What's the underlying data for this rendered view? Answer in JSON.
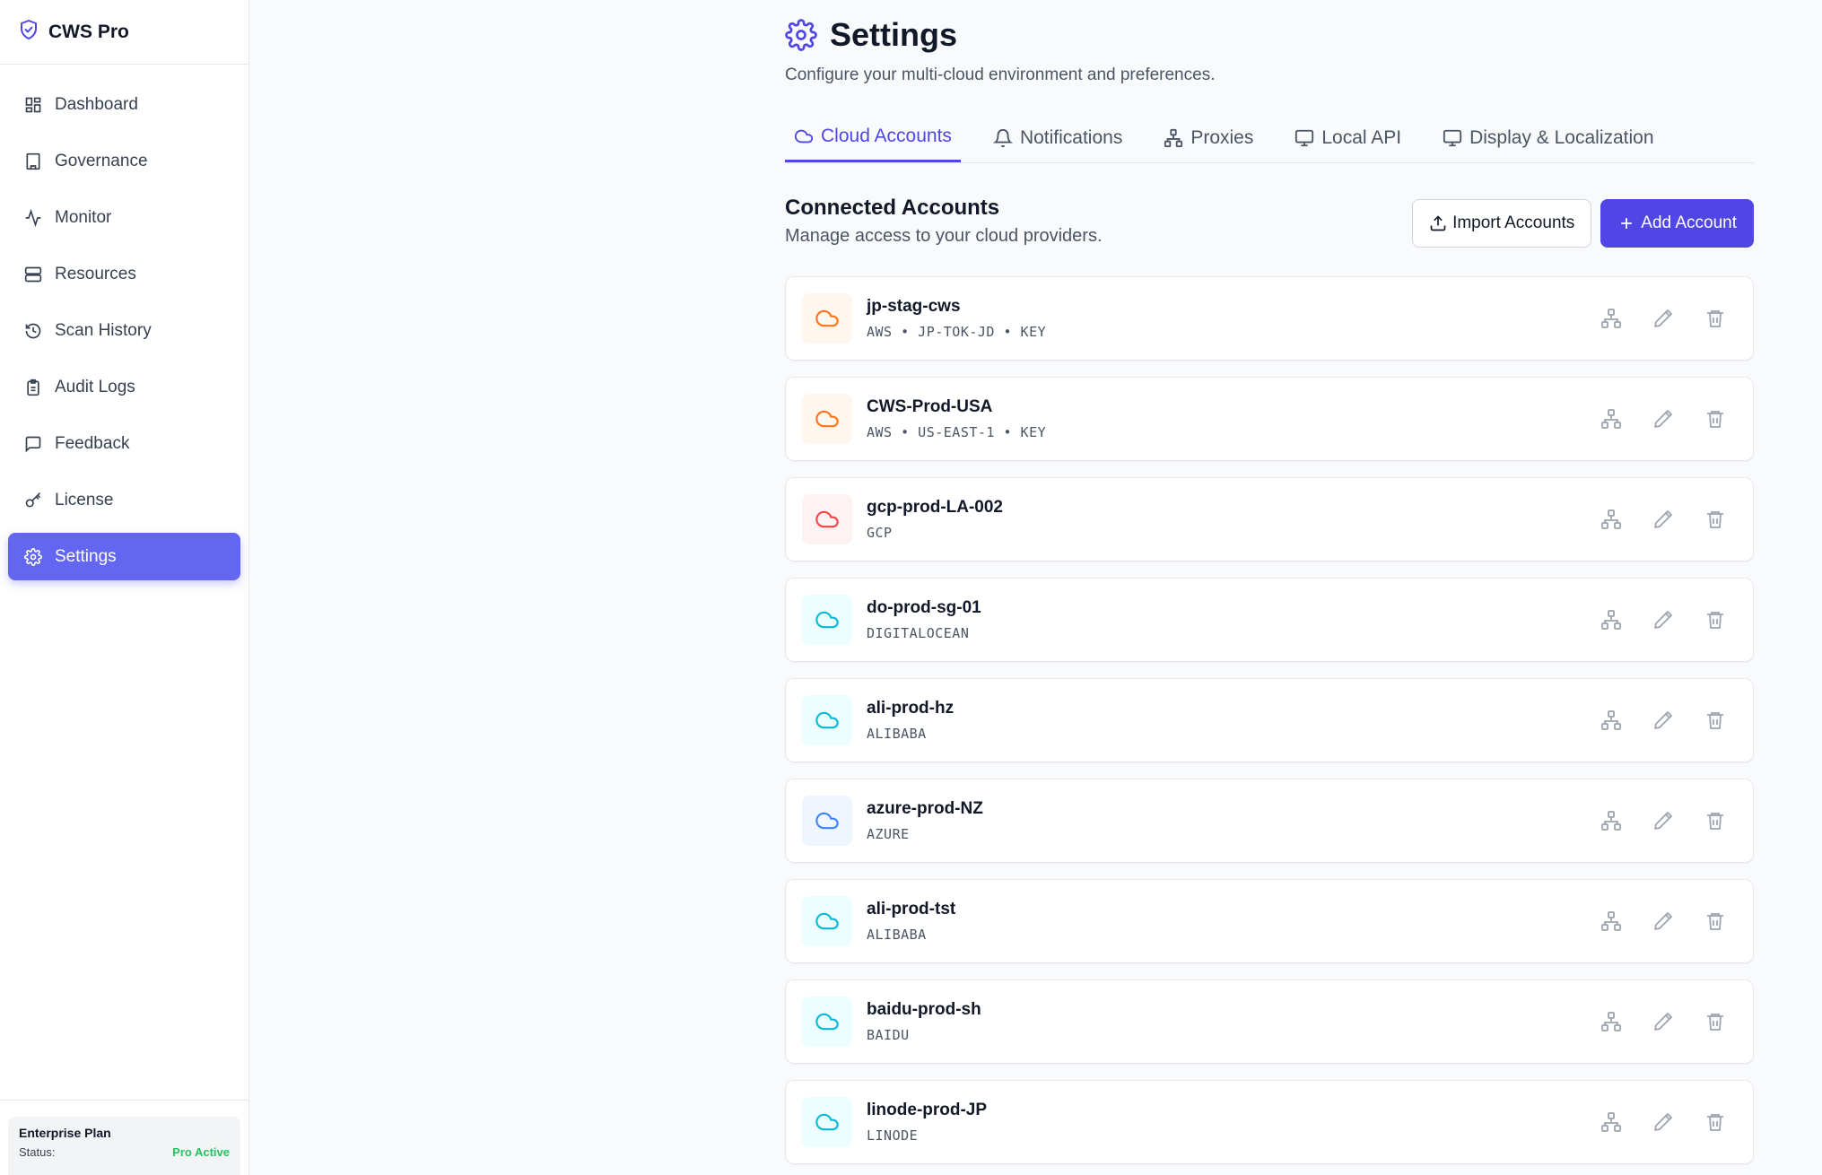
{
  "app": {
    "name": "CWS Pro"
  },
  "sidebar": {
    "items": [
      {
        "label": "Dashboard",
        "icon": "dashboard-icon"
      },
      {
        "label": "Governance",
        "icon": "building-icon"
      },
      {
        "label": "Monitor",
        "icon": "activity-icon"
      },
      {
        "label": "Resources",
        "icon": "server-icon"
      },
      {
        "label": "Scan History",
        "icon": "history-icon"
      },
      {
        "label": "Audit Logs",
        "icon": "clipboard-icon"
      },
      {
        "label": "Feedback",
        "icon": "message-icon"
      },
      {
        "label": "License",
        "icon": "key-icon"
      },
      {
        "label": "Settings",
        "icon": "gear-icon",
        "active": true
      }
    ],
    "plan": {
      "title": "Enterprise Plan",
      "status_label": "Status:",
      "status_value": "Pro Active"
    }
  },
  "header": {
    "title": "Settings",
    "subtitle": "Configure your multi-cloud environment and preferences."
  },
  "tabs": [
    {
      "label": "Cloud Accounts",
      "icon": "cloud-icon",
      "active": true
    },
    {
      "label": "Notifications",
      "icon": "bell-icon"
    },
    {
      "label": "Proxies",
      "icon": "network-icon"
    },
    {
      "label": "Local API",
      "icon": "monitor-icon"
    },
    {
      "label": "Display & Localization",
      "icon": "monitor-icon"
    }
  ],
  "section": {
    "title": "Connected Accounts",
    "subtitle": "Manage access to your cloud providers.",
    "import_label": "Import Accounts",
    "add_label": "Add Account"
  },
  "accounts": [
    {
      "name": "jp-stag-cws",
      "meta": "AWS • JP-TOK-JD • KEY",
      "color": "#f97316",
      "bg": "#fff7ed"
    },
    {
      "name": "CWS-Prod-USA",
      "meta": "AWS • US-EAST-1 • KEY",
      "color": "#f97316",
      "bg": "#fff7ed"
    },
    {
      "name": "gcp-prod-LA-002",
      "meta": "GCP",
      "color": "#ef4444",
      "bg": "#fef2f2"
    },
    {
      "name": "do-prod-sg-01",
      "meta": "DIGITALOCEAN",
      "color": "#06b6d4",
      "bg": "#ecfeff"
    },
    {
      "name": "ali-prod-hz",
      "meta": "ALIBABA",
      "color": "#06b6d4",
      "bg": "#ecfeff"
    },
    {
      "name": "azure-prod-NZ",
      "meta": "AZURE",
      "color": "#3b82f6",
      "bg": "#eff6ff"
    },
    {
      "name": "ali-prod-tst",
      "meta": "ALIBABA",
      "color": "#06b6d4",
      "bg": "#ecfeff"
    },
    {
      "name": "baidu-prod-sh",
      "meta": "BAIDU",
      "color": "#06b6d4",
      "bg": "#ecfeff"
    },
    {
      "name": "linode-prod-JP",
      "meta": "LINODE",
      "color": "#06b6d4",
      "bg": "#ecfeff"
    }
  ],
  "colors": {
    "accent": "#4f46e5",
    "active_nav": "#6366f1",
    "status_ok": "#22c55e"
  }
}
